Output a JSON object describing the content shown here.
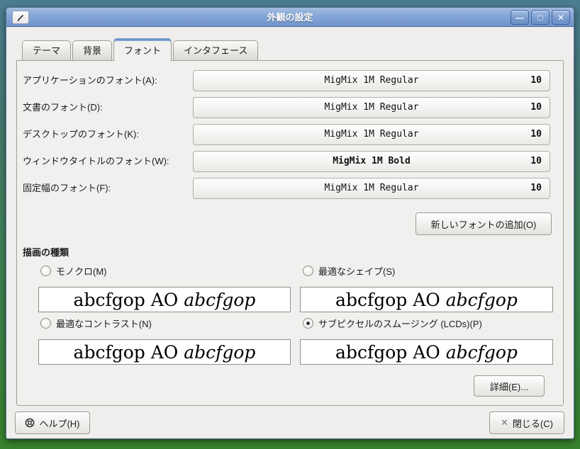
{
  "window": {
    "title": "外観の設定",
    "controls": {
      "minimize": "—",
      "maximize": "□",
      "close": "✕"
    }
  },
  "tabs": [
    {
      "label": "テーマ",
      "active": false
    },
    {
      "label": "背景",
      "active": false
    },
    {
      "label": "フォント",
      "active": true
    },
    {
      "label": "インタフェース",
      "active": false
    }
  ],
  "font_rows": [
    {
      "label": "アプリケーションのフォント(A):",
      "font": "MigMix 1M Regular",
      "size": "10",
      "bold": false
    },
    {
      "label": "文書のフォント(D):",
      "font": "MigMix 1M Regular",
      "size": "10",
      "bold": false
    },
    {
      "label": "デスクトップのフォント(K):",
      "font": "MigMix 1M Regular",
      "size": "10",
      "bold": false
    },
    {
      "label": "ウィンドウタイトルのフォント(W):",
      "font": "MigMix 1M Bold",
      "size": "10",
      "bold": true
    },
    {
      "label": "固定幅のフォント(F):",
      "font": "MigMix 1M Regular",
      "size": "10",
      "bold": false
    }
  ],
  "add_font_button": "新しいフォントの追加(O)",
  "rendering": {
    "heading": "描画の種類",
    "options": [
      {
        "label": "モノクロ(M)",
        "selected": false
      },
      {
        "label": "最適なシェイプ(S)",
        "selected": false
      },
      {
        "label": "最適なコントラスト(N)",
        "selected": false
      },
      {
        "label": "サブピクセルのスムージング (LCDs)(P)",
        "selected": true
      }
    ],
    "preview_normal": "abcfgop AO ",
    "preview_italic": "abcfgop"
  },
  "details_button": "詳細(E)...",
  "help_button": "ヘルプ(H)",
  "close_button": "閉じる(C)",
  "close_button_glyph": "✕",
  "icons": {
    "window_icon": "pencil-app-icon",
    "help_icon": "life-buoy",
    "close_icon": "x-mark"
  },
  "colors": {
    "titlebar_blue": "#7d9fd4",
    "tab_accent": "#6d95c9",
    "dialog_bg": "#efeeec",
    "desktop_top": "#4c7c91",
    "desktop_bottom": "#37822c",
    "radio_dot": "#2e3436"
  }
}
